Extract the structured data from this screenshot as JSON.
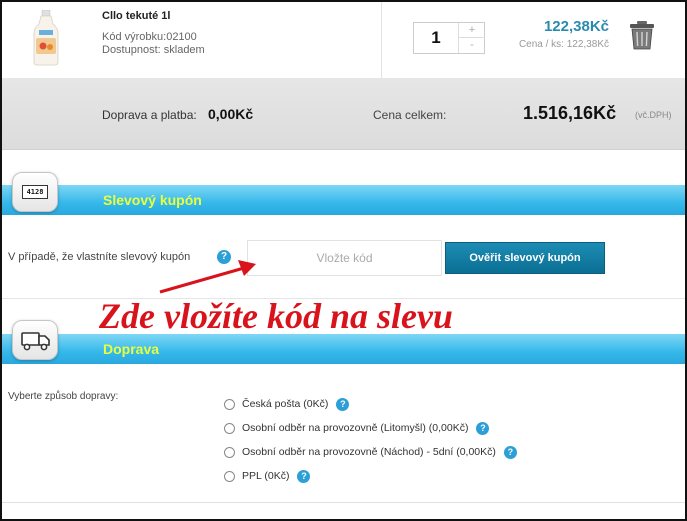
{
  "product": {
    "name": "Cllo tekuté 1l",
    "code": "Kód výrobku:02100",
    "availability": "Dostupnost: skladem",
    "quantity": "1",
    "qty_increment": "+",
    "qty_decrement": "-",
    "price": "122,38Kč",
    "unit_price": "Cena / ks: 122,38Kč",
    "icon_thumb": "product-bottle-image",
    "icon_remove": "trash-icon"
  },
  "totals": {
    "shipping_label": "Doprava a platba:",
    "shipping_value": "0,00Kč",
    "total_label": "Cena celkem:",
    "total_value": "1.516,16Kč",
    "vat_note": "(vč.DPH)"
  },
  "coupon": {
    "section_title": "Slevový kupón",
    "icon_label": "4128",
    "icon": "coupon-card-icon",
    "prompt": "V případě, že vlastníte slevový kupón",
    "help": "?",
    "input_placeholder": "Vložte kód",
    "button_label": "Ověřit slevový kupón"
  },
  "annotation": {
    "text": "Zde vložíte kód na slevu",
    "color": "#d9131b"
  },
  "shipping": {
    "section_title": "Doprava",
    "icon": "truck-icon",
    "prompt": "Vyberte způsob dopravy:",
    "options": [
      {
        "label": "Česká pošta (0Kč)",
        "help": "?"
      },
      {
        "label": "Osobní odběr na provozovně (Litomyšl) (0,00Kč)",
        "help": "?"
      },
      {
        "label": "Osobní odběr na provozovně (Náchod) - 5dní (0,00Kč)",
        "help": "?"
      },
      {
        "label": "PPL (0Kč)",
        "help": "?"
      }
    ]
  },
  "colors": {
    "accent": "#2aa8dd",
    "section_title": "#e9ff3c",
    "price": "#2a8bb0",
    "button": "#0b6f93"
  }
}
